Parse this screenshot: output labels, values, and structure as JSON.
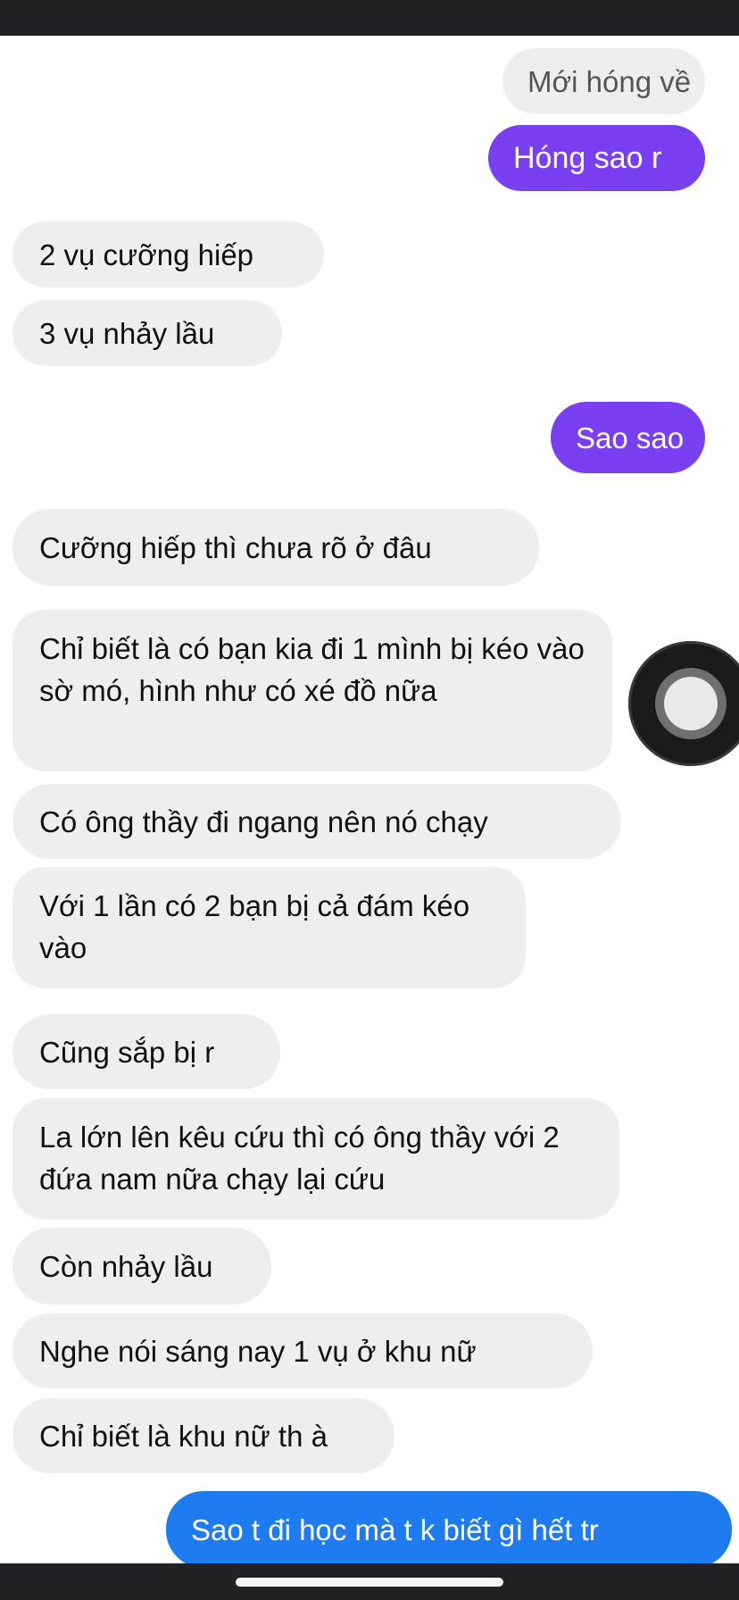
{
  "messages": [
    {
      "id": "m1",
      "side": "sent",
      "style": "gray",
      "text": "Mới hóng về"
    },
    {
      "id": "m2",
      "side": "sent",
      "style": "purple",
      "text": "Hóng sao r"
    },
    {
      "id": "m3",
      "side": "received",
      "text": "2 vụ cưỡng hiếp"
    },
    {
      "id": "m4",
      "side": "received",
      "text": "3 vụ nhảy lầu"
    },
    {
      "id": "m5",
      "side": "sent",
      "style": "purple",
      "text": "Sao sao"
    },
    {
      "id": "m6",
      "side": "received",
      "text": "Cưỡng hiếp thì chưa rõ ở đâu"
    },
    {
      "id": "m7",
      "side": "received",
      "text": "Chỉ biết là có bạn kia đi 1 mình bị kéo vào sờ mó, hình như có xé đồ nữa"
    },
    {
      "id": "m8",
      "side": "received",
      "text": "Có ông thầy đi ngang nên nó chạy"
    },
    {
      "id": "m9",
      "side": "received",
      "text": "Với 1 lần có 2 bạn bị cả đám kéo vào"
    },
    {
      "id": "m10",
      "side": "received",
      "text": "Cũng sắp bị r"
    },
    {
      "id": "m11",
      "side": "received",
      "text": "La lớn lên kêu cứu thì có ông thầy với 2 đứa nam nữa chạy lại cứu"
    },
    {
      "id": "m12",
      "side": "received",
      "text": "Còn nhảy lầu"
    },
    {
      "id": "m13",
      "side": "received",
      "text": "Nghe nói sáng nay 1 vụ ở khu nữ"
    },
    {
      "id": "m14",
      "side": "received",
      "text": "Chỉ biết là khu nữ th à"
    },
    {
      "id": "m15",
      "side": "sent",
      "style": "blue",
      "text": "Sao t đi học mà t k biết gì hết tr"
    }
  ],
  "colors": {
    "status_bar": "#222225",
    "received_bubble": "#eeeeef",
    "sent_gray_bubble": "#eeeeef",
    "sent_purple_bubble": "#7b3ff2",
    "sent_blue_bubble": "#1e7cf0",
    "background": "#ffffff"
  },
  "icons": {
    "assistive_touch": "assistive-touch-icon",
    "home_indicator": "home-indicator"
  }
}
